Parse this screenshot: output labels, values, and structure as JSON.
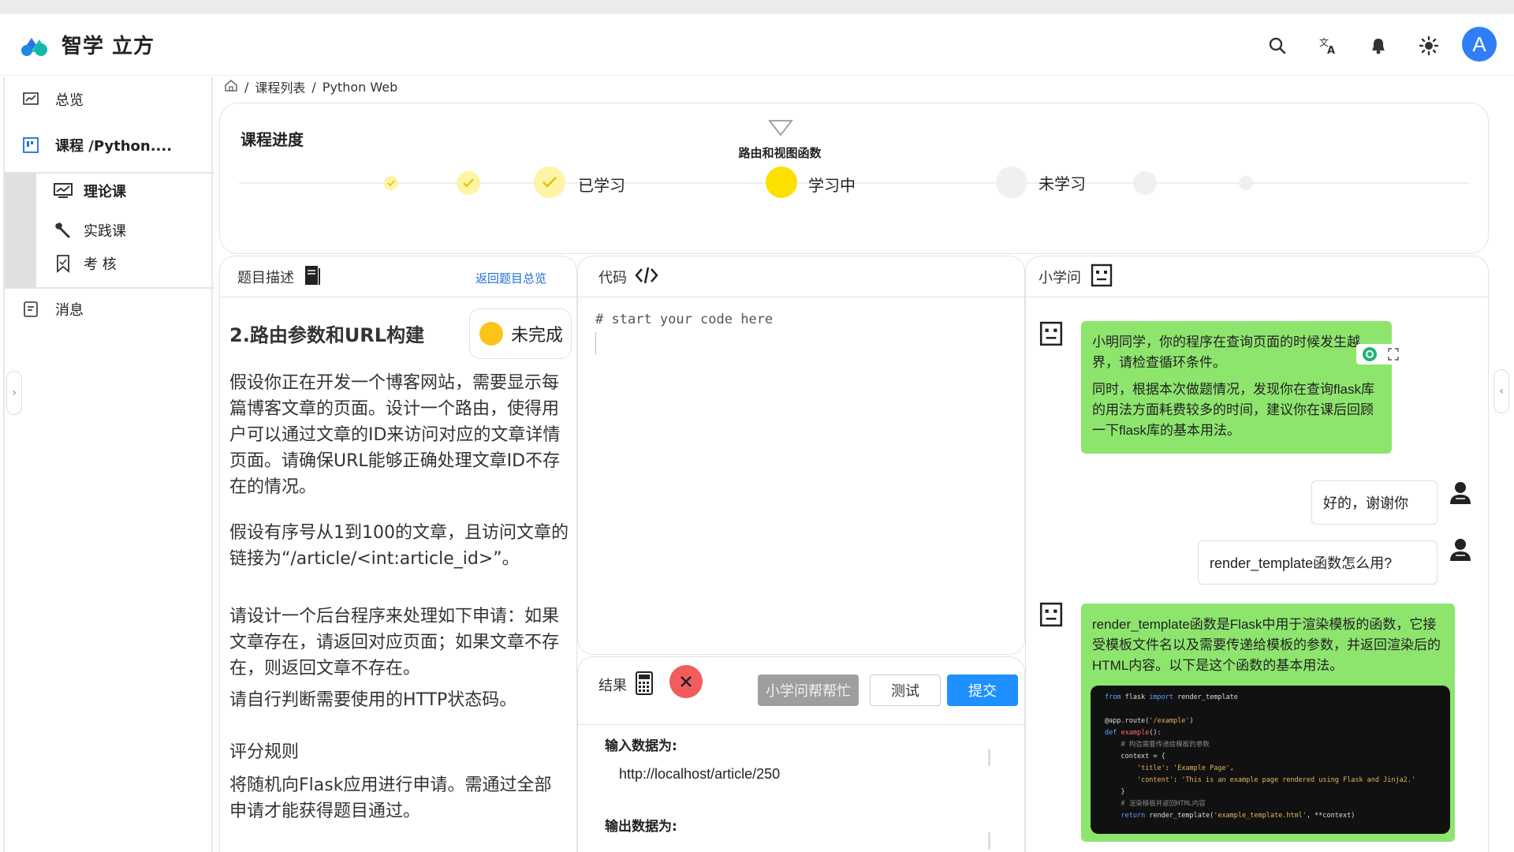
{
  "app": {
    "title": "智学 立方",
    "avatar_letter": "A",
    "accent": "#2f7ef5"
  },
  "header_icons": [
    "search-icon",
    "translate-icon",
    "bell-icon",
    "theme-icon"
  ],
  "sidebar": {
    "overview": "总览",
    "course": "课程 /Python....",
    "sub_items": [
      {
        "label": "理论课",
        "icon": "chart-icon"
      },
      {
        "label": "实践课",
        "icon": "wrench-icon"
      },
      {
        "label": "考 核",
        "icon": "bookmark-icon"
      }
    ],
    "messages": "消息"
  },
  "breadcrumb": {
    "courses": "课程列表",
    "current": "Python Web"
  },
  "progress": {
    "title": "课程进度",
    "current_topic": "路由和视图函数",
    "learned_label": "已学习",
    "learning_label": "学习中",
    "unlearned_label": "未学习",
    "colors": {
      "learned": "#fff3a6",
      "learning": "#fde000",
      "unlearned": "#f0f0f0"
    }
  },
  "description": {
    "panel_title": "题目描述",
    "back_link": "返回题目总览",
    "question_title": "2.路由参数和URL构建",
    "status": "未完成",
    "paragraphs": [
      "假设你正在开发一个博客网站，需要显示每篇博客文章的页面。设计一个路由，使得用户可以通过文章的ID来访问对应的文章详情页面。请确保URL能够正确处理文章ID不存在的情况。",
      "假设有序号从1到100的文章，且访问文章的链接为“/article/<int:article_id>”。",
      "请设计一个后台程序来处理如下申请：如果文章存在，请返回对应页面；如果文章不存在，则返回文章不存在。",
      "请自行判断需要使用的HTTP状态码。",
      "评分规则",
      "将随机向Flask应用进行申请。需通过全部申请才能获得题目通过。"
    ]
  },
  "code": {
    "panel_title": "代码",
    "placeholder": "# start your code here"
  },
  "result": {
    "panel_title": "结果",
    "help_button": "小学问帮帮忙",
    "test_button": "测试",
    "submit_button": "提交",
    "input_label": "输入数据为:",
    "input_value": "http://localhost/article/250",
    "output_label": "输出数据为:"
  },
  "chat": {
    "panel_title": "小学问",
    "messages": [
      {
        "from": "bot",
        "lines": [
          "小明同学，你的程序在查询页面的时候发生越界，请检查循环条件。",
          "同时，根据本次做题情况，发现你在查询flask库的用法方面耗费较多的时间，建议你在课后回顾一下flask库的基本用法。"
        ]
      },
      {
        "from": "user",
        "text": "好的，谢谢你"
      },
      {
        "from": "user",
        "text": "render_template函数怎么用?"
      },
      {
        "from": "bot",
        "lines": [
          "render_template函数是Flask中用于渲染模板的函数，它接受模板文件名以及需要传递给模板的参数，并返回渲染后的HTML内容。以下是这个函数的基本用法。"
        ]
      }
    ],
    "code_lines": [
      "from flask import render_template",
      "",
      "@app.route('/example')",
      "def example():",
      "    # 构造需要传递给模板的参数",
      "    context = {",
      "        'title': 'Example Page',",
      "        'content': 'This is an example page rendered using Flask and Jinja2.'",
      "    }",
      "    # 渲染模板并返回HTML内容",
      "    return render_template('example_template.html', **context)"
    ]
  }
}
